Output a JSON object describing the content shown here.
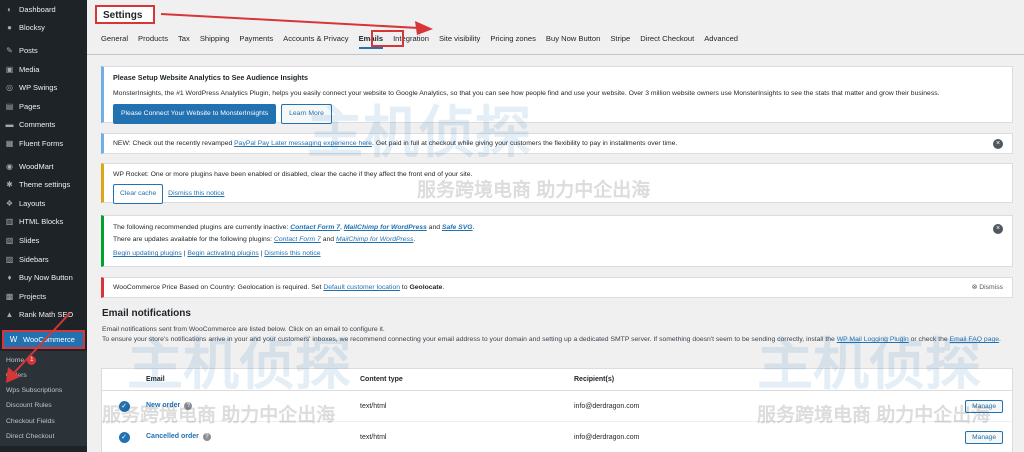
{
  "sidebar": {
    "items": [
      {
        "label": "Dashboard",
        "icon": "dashboard-icon",
        "glyph": "◐"
      },
      {
        "label": "Blocksy",
        "icon": "blocksy-icon",
        "glyph": "●"
      },
      {
        "label": "Posts",
        "icon": "pin-icon",
        "glyph": "✎"
      },
      {
        "label": "Media",
        "icon": "media-icon",
        "glyph": "▣"
      },
      {
        "label": "WP Swings",
        "icon": "swings-icon",
        "glyph": "◎"
      },
      {
        "label": "Pages",
        "icon": "pages-icon",
        "glyph": "▤"
      },
      {
        "label": "Comments",
        "icon": "comments-icon",
        "glyph": "▬"
      },
      {
        "label": "Fluent Forms",
        "icon": "forms-icon",
        "glyph": "▦"
      },
      {
        "label": "WoodMart",
        "icon": "woodmart-icon",
        "glyph": "◉"
      },
      {
        "label": "Theme settings",
        "icon": "theme-settings-icon",
        "glyph": "✱"
      },
      {
        "label": "Layouts",
        "icon": "layouts-icon",
        "glyph": "❖"
      },
      {
        "label": "HTML Blocks",
        "icon": "html-blocks-icon",
        "glyph": "▥"
      },
      {
        "label": "Slides",
        "icon": "slides-icon",
        "glyph": "▧"
      },
      {
        "label": "Sidebars",
        "icon": "sidebars-icon",
        "glyph": "▨"
      },
      {
        "label": "Buy Now Button",
        "icon": "cart-icon",
        "glyph": "♦"
      },
      {
        "label": "Projects",
        "icon": "projects-icon",
        "glyph": "▩"
      },
      {
        "label": "Rank Math SEO",
        "icon": "rankmath-icon",
        "glyph": "▲"
      },
      {
        "label": "WooCommerce",
        "icon": "woocommerce-icon",
        "glyph": "W"
      }
    ],
    "submenu": [
      {
        "label": "Home",
        "badge": "1"
      },
      {
        "label": "Orders"
      },
      {
        "label": "Wps Subscriptions"
      },
      {
        "label": "Discount Rules"
      },
      {
        "label": "Checkout Fields"
      },
      {
        "label": "Direct Checkout"
      }
    ]
  },
  "header": {
    "title": "Settings"
  },
  "tabs": [
    {
      "label": "General"
    },
    {
      "label": "Products"
    },
    {
      "label": "Tax"
    },
    {
      "label": "Shipping"
    },
    {
      "label": "Payments"
    },
    {
      "label": "Accounts & Privacy"
    },
    {
      "label": "Emails",
      "active": true
    },
    {
      "label": "Integration"
    },
    {
      "label": "Site visibility"
    },
    {
      "label": "Pricing zones"
    },
    {
      "label": "Buy Now Button"
    },
    {
      "label": "Stripe"
    },
    {
      "label": "Direct Checkout"
    },
    {
      "label": "Advanced"
    }
  ],
  "notices": {
    "monsterinsights": {
      "title": "Please Setup Website Analytics to See Audience Insights",
      "body": "MonsterInsights, the #1 WordPress Analytics Plugin, helps you easily connect your website to Google Analytics, so that you can see how people find and use your website. Over 3 million website owners use MonsterInsights to see the stats that matter and grow their business.",
      "primary": "Please Connect Your Website to MonsterInsights",
      "secondary": "Learn More"
    },
    "paypal": {
      "prefix": "NEW: Check out the recently revamped ",
      "link": "PayPal Pay Later messaging experience here",
      "suffix": ". Get paid in full at checkout while giving your customers the flexibility to pay in installments over time."
    },
    "wprocket": {
      "body": "WP Rocket: One or more plugins have been enabled or disabled, clear the cache if they affect the front end of your site.",
      "button": "Clear cache",
      "dismiss": "Dismiss this notice"
    },
    "plugins": {
      "line1_prefix": "The following recommended plugins are currently inactive: ",
      "p1": "Contact Form 7",
      "sep1": ", ",
      "p2": "MailChimp for WordPress",
      "sep2": " and ",
      "p3": "Safe SVG",
      "end1": ".",
      "line2_prefix": "There are updates available for the following plugins: ",
      "u1": "Contact Form 7",
      "sep3": " and ",
      "u2": "MailChimp for WordPress",
      "end2": ".",
      "link_update": "Begin updating plugins",
      "link_activate": "Begin activating plugins",
      "link_dismiss": "Dismiss this notice",
      "pipe": " | "
    },
    "pricebased": {
      "prefix": "WooCommerce Price Based on Country: Geolocation is required. Set ",
      "link": "Default customer location",
      "mid": " to ",
      "bold": "Geolocate",
      "end": ".",
      "dismiss": "Dismiss"
    }
  },
  "emails": {
    "title": "Email notifications",
    "desc1": "Email notifications sent from WooCommerce are listed below. Click on an email to configure it.",
    "desc2_prefix": "To ensure your store's notifications arrive in your and your customers' inboxes, we recommend connecting your email address to your domain and setting up a dedicated SMTP server. If something doesn't seem to be sending correctly, install the ",
    "desc2_link": "WP Mail Logging Plugin",
    "desc2_mid": " or check the ",
    "desc2_link2": "Email FAQ page",
    "desc2_end": ".",
    "columns": {
      "email": "Email",
      "content_type": "Content type",
      "recipients": "Recipient(s)"
    },
    "rows": [
      {
        "name": "New order",
        "content_type": "text/html",
        "recipient": "info@derdragon.com",
        "action": "Manage"
      },
      {
        "name": "Cancelled order",
        "content_type": "text/html",
        "recipient": "info@derdragon.com",
        "action": "Manage"
      }
    ]
  },
  "watermark": {
    "brand": "主机侦探",
    "slogan": "服务跨境电商 助力中企出海"
  },
  "colors": {
    "sidebar_bg": "#1d2327",
    "accent": "#2271b1",
    "highlight_red": "#d63638"
  }
}
